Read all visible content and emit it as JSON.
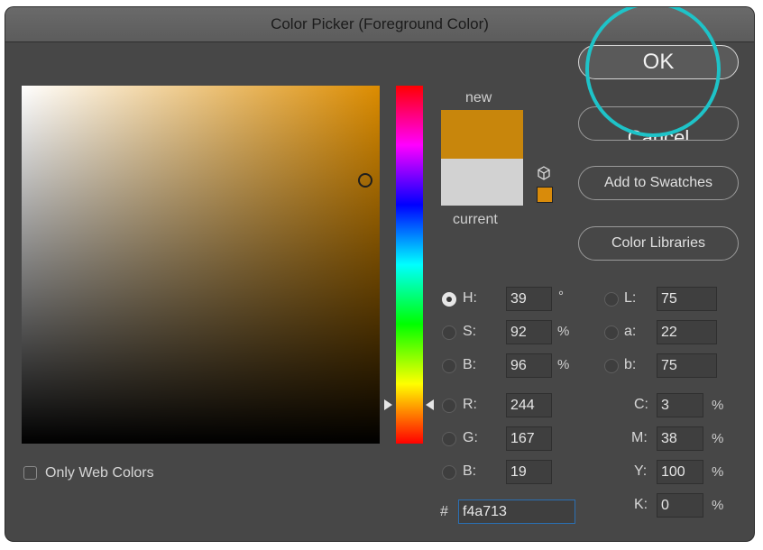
{
  "window": {
    "title": "Color Picker (Foreground Color)"
  },
  "labels": {
    "new": "new",
    "current": "current"
  },
  "colors": {
    "new": "#c8860c",
    "current": "#d2d2d2",
    "highlight_ring": "#1ec3c8"
  },
  "icons": {
    "gamut_warning": "cube-icon",
    "web_safe": "swatch-icon"
  },
  "buttons": {
    "ok": "OK",
    "cancel": "Cancel",
    "add_to_swatches": "Add to Swatches",
    "color_libraries": "Color Libraries"
  },
  "selected_mode": "H",
  "fields": {
    "H": {
      "label": "H:",
      "value": "39",
      "unit": "°"
    },
    "S": {
      "label": "S:",
      "value": "92",
      "unit": "%"
    },
    "B": {
      "label": "B:",
      "value": "96",
      "unit": "%"
    },
    "R": {
      "label": "R:",
      "value": "244"
    },
    "G": {
      "label": "G:",
      "value": "167"
    },
    "Bl": {
      "label": "B:",
      "value": "19"
    },
    "L": {
      "label": "L:",
      "value": "75"
    },
    "a": {
      "label": "a:",
      "value": "22"
    },
    "b": {
      "label": "b:",
      "value": "75"
    },
    "C": {
      "label": "C:",
      "value": "3",
      "unit": "%"
    },
    "M": {
      "label": "M:",
      "value": "38",
      "unit": "%"
    },
    "Y": {
      "label": "Y:",
      "value": "100",
      "unit": "%"
    },
    "K": {
      "label": "K:",
      "value": "0",
      "unit": "%"
    }
  },
  "hex": {
    "label": "#",
    "value": "f4a713"
  },
  "web_colors": {
    "label": "Only Web Colors",
    "checked": false
  }
}
